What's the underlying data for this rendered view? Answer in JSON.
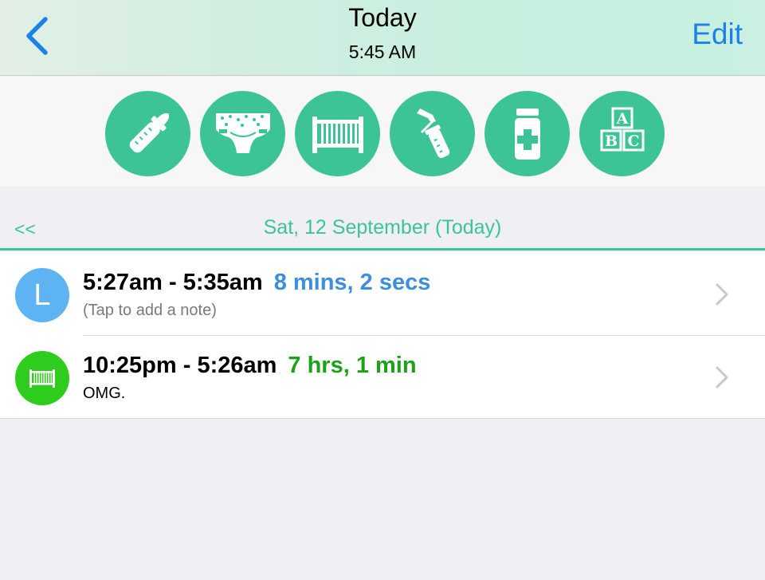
{
  "nav": {
    "title": "Today",
    "subtitle": "5:45 AM",
    "edit_label": "Edit",
    "back_icon": "chevron-left-icon",
    "accent_color": "#1a82e8"
  },
  "categories": [
    {
      "name": "bottle-icon"
    },
    {
      "name": "diaper-icon"
    },
    {
      "name": "crib-icon"
    },
    {
      "name": "breast-pump-icon"
    },
    {
      "name": "medicine-icon"
    },
    {
      "name": "abc-blocks-icon"
    }
  ],
  "theme": {
    "green": "#3cc497"
  },
  "day": {
    "prev_label": "<<",
    "label": "Sat, 12 September (Today)"
  },
  "entries": [
    {
      "avatar_letter": "L",
      "avatar_color": "#5eb3f3",
      "time_range": "5:27am - 5:35am",
      "duration": "8 mins, 2 secs",
      "duration_color": "#3b8fdb",
      "note": "(Tap to add a note)",
      "note_color": "#7a7a7a"
    },
    {
      "avatar_icon": "crib-icon",
      "avatar_color": "#2ecc1d",
      "time_range": "10:25pm - 5:26am",
      "duration": "7 hrs, 1 min",
      "duration_color": "#1aa317",
      "note": "OMG.",
      "note_color": "#000000"
    }
  ]
}
